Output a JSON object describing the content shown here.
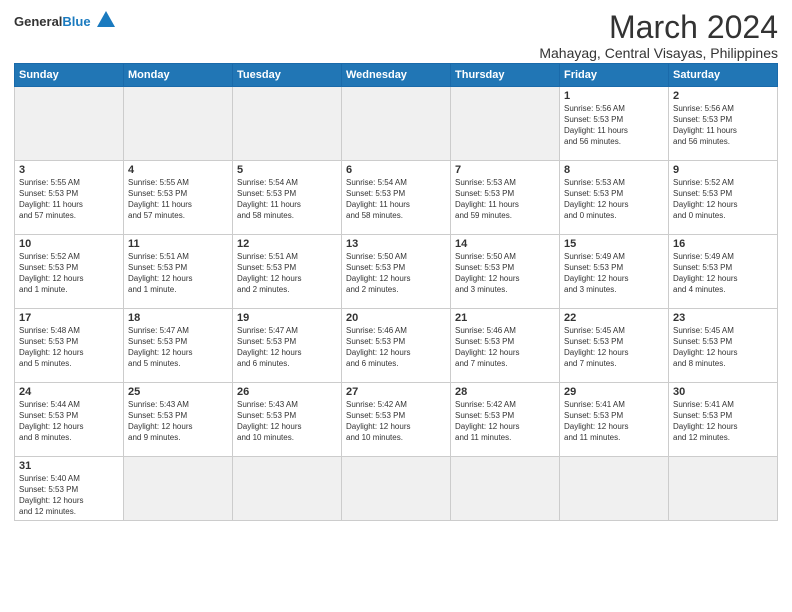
{
  "header": {
    "logo_general": "General",
    "logo_blue": "Blue",
    "month_title": "March 2024",
    "location": "Mahayag, Central Visayas, Philippines"
  },
  "days_of_week": [
    "Sunday",
    "Monday",
    "Tuesday",
    "Wednesday",
    "Thursday",
    "Friday",
    "Saturday"
  ],
  "weeks": [
    [
      {
        "day": "",
        "empty": true
      },
      {
        "day": "",
        "empty": true
      },
      {
        "day": "",
        "empty": true
      },
      {
        "day": "",
        "empty": true
      },
      {
        "day": "",
        "empty": true
      },
      {
        "day": "1",
        "info": "Sunrise: 5:56 AM\nSunset: 5:53 PM\nDaylight: 11 hours\nand 56 minutes."
      },
      {
        "day": "2",
        "info": "Sunrise: 5:56 AM\nSunset: 5:53 PM\nDaylight: 11 hours\nand 56 minutes."
      }
    ],
    [
      {
        "day": "3",
        "info": "Sunrise: 5:55 AM\nSunset: 5:53 PM\nDaylight: 11 hours\nand 57 minutes."
      },
      {
        "day": "4",
        "info": "Sunrise: 5:55 AM\nSunset: 5:53 PM\nDaylight: 11 hours\nand 57 minutes."
      },
      {
        "day": "5",
        "info": "Sunrise: 5:54 AM\nSunset: 5:53 PM\nDaylight: 11 hours\nand 58 minutes."
      },
      {
        "day": "6",
        "info": "Sunrise: 5:54 AM\nSunset: 5:53 PM\nDaylight: 11 hours\nand 58 minutes."
      },
      {
        "day": "7",
        "info": "Sunrise: 5:53 AM\nSunset: 5:53 PM\nDaylight: 11 hours\nand 59 minutes."
      },
      {
        "day": "8",
        "info": "Sunrise: 5:53 AM\nSunset: 5:53 PM\nDaylight: 12 hours\nand 0 minutes."
      },
      {
        "day": "9",
        "info": "Sunrise: 5:52 AM\nSunset: 5:53 PM\nDaylight: 12 hours\nand 0 minutes."
      }
    ],
    [
      {
        "day": "10",
        "info": "Sunrise: 5:52 AM\nSunset: 5:53 PM\nDaylight: 12 hours\nand 1 minute."
      },
      {
        "day": "11",
        "info": "Sunrise: 5:51 AM\nSunset: 5:53 PM\nDaylight: 12 hours\nand 1 minute."
      },
      {
        "day": "12",
        "info": "Sunrise: 5:51 AM\nSunset: 5:53 PM\nDaylight: 12 hours\nand 2 minutes."
      },
      {
        "day": "13",
        "info": "Sunrise: 5:50 AM\nSunset: 5:53 PM\nDaylight: 12 hours\nand 2 minutes."
      },
      {
        "day": "14",
        "info": "Sunrise: 5:50 AM\nSunset: 5:53 PM\nDaylight: 12 hours\nand 3 minutes."
      },
      {
        "day": "15",
        "info": "Sunrise: 5:49 AM\nSunset: 5:53 PM\nDaylight: 12 hours\nand 3 minutes."
      },
      {
        "day": "16",
        "info": "Sunrise: 5:49 AM\nSunset: 5:53 PM\nDaylight: 12 hours\nand 4 minutes."
      }
    ],
    [
      {
        "day": "17",
        "info": "Sunrise: 5:48 AM\nSunset: 5:53 PM\nDaylight: 12 hours\nand 5 minutes."
      },
      {
        "day": "18",
        "info": "Sunrise: 5:47 AM\nSunset: 5:53 PM\nDaylight: 12 hours\nand 5 minutes."
      },
      {
        "day": "19",
        "info": "Sunrise: 5:47 AM\nSunset: 5:53 PM\nDaylight: 12 hours\nand 6 minutes."
      },
      {
        "day": "20",
        "info": "Sunrise: 5:46 AM\nSunset: 5:53 PM\nDaylight: 12 hours\nand 6 minutes."
      },
      {
        "day": "21",
        "info": "Sunrise: 5:46 AM\nSunset: 5:53 PM\nDaylight: 12 hours\nand 7 minutes."
      },
      {
        "day": "22",
        "info": "Sunrise: 5:45 AM\nSunset: 5:53 PM\nDaylight: 12 hours\nand 7 minutes."
      },
      {
        "day": "23",
        "info": "Sunrise: 5:45 AM\nSunset: 5:53 PM\nDaylight: 12 hours\nand 8 minutes."
      }
    ],
    [
      {
        "day": "24",
        "info": "Sunrise: 5:44 AM\nSunset: 5:53 PM\nDaylight: 12 hours\nand 8 minutes."
      },
      {
        "day": "25",
        "info": "Sunrise: 5:43 AM\nSunset: 5:53 PM\nDaylight: 12 hours\nand 9 minutes."
      },
      {
        "day": "26",
        "info": "Sunrise: 5:43 AM\nSunset: 5:53 PM\nDaylight: 12 hours\nand 10 minutes."
      },
      {
        "day": "27",
        "info": "Sunrise: 5:42 AM\nSunset: 5:53 PM\nDaylight: 12 hours\nand 10 minutes."
      },
      {
        "day": "28",
        "info": "Sunrise: 5:42 AM\nSunset: 5:53 PM\nDaylight: 12 hours\nand 11 minutes."
      },
      {
        "day": "29",
        "info": "Sunrise: 5:41 AM\nSunset: 5:53 PM\nDaylight: 12 hours\nand 11 minutes."
      },
      {
        "day": "30",
        "info": "Sunrise: 5:41 AM\nSunset: 5:53 PM\nDaylight: 12 hours\nand 12 minutes."
      }
    ],
    [
      {
        "day": "31",
        "info": "Sunrise: 5:40 AM\nSunset: 5:53 PM\nDaylight: 12 hours\nand 12 minutes.",
        "last": true
      },
      {
        "day": "",
        "empty": true,
        "last": true
      },
      {
        "day": "",
        "empty": true,
        "last": true
      },
      {
        "day": "",
        "empty": true,
        "last": true
      },
      {
        "day": "",
        "empty": true,
        "last": true
      },
      {
        "day": "",
        "empty": true,
        "last": true
      },
      {
        "day": "",
        "empty": true,
        "last": true
      }
    ]
  ]
}
